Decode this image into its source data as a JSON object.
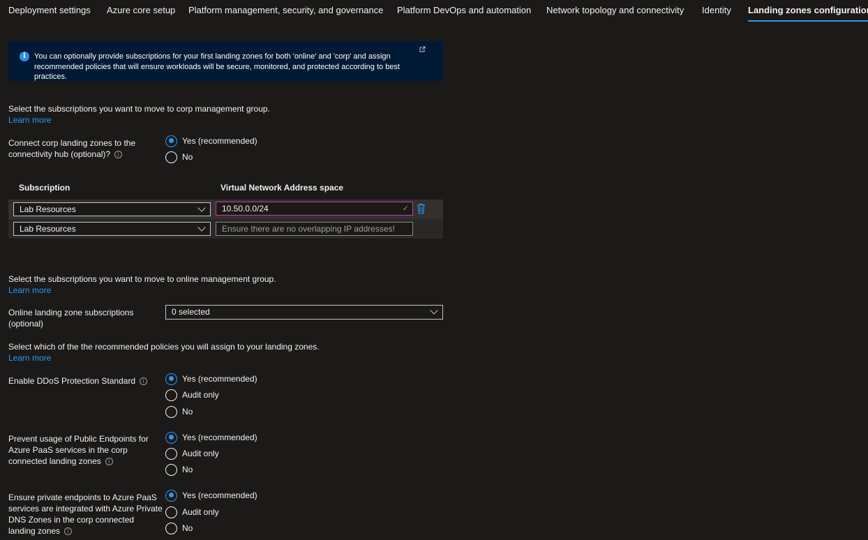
{
  "tabs": [
    {
      "label": "Deployment settings",
      "active": false
    },
    {
      "label": "Azure core setup",
      "active": false
    },
    {
      "label": "Platform management, security, and governance",
      "active": false
    },
    {
      "label": "Platform DevOps and automation",
      "active": false
    },
    {
      "label": "Network topology and connectivity",
      "active": false
    },
    {
      "label": "Identity",
      "active": false
    },
    {
      "label": "Landing zones configuration",
      "active": true
    }
  ],
  "info": {
    "icon": "info-icon",
    "text": "You can optionally provide subscriptions for your first landing zones for both 'online' and 'corp' and assign recommended policies that will ensure workloads will be secure, monitored, and protected according to best practices.",
    "external_icon": "external-link-icon"
  },
  "corp": {
    "intro": "Select the subscriptions you want to move to corp management group.",
    "learn_more": "Learn more",
    "connect_label": "Connect corp landing zones to the connectivity hub (optional)?",
    "connect_options": [
      {
        "label": "Yes (recommended)",
        "checked": true
      },
      {
        "label": "No",
        "checked": false
      }
    ],
    "grid": {
      "headers": [
        "Subscription",
        "Virtual Network Address space"
      ],
      "rows": [
        {
          "subscription": "Lab Resources",
          "address": "10.50.0.0/24",
          "placeholder": "",
          "valid": true
        },
        {
          "subscription": "Lab Resources",
          "address": "",
          "placeholder": "Ensure there are no overlapping IP addresses!",
          "valid": false
        }
      ]
    }
  },
  "online": {
    "intro": "Select the subscriptions you want to move to online management group.",
    "learn_more": "Learn more",
    "subs_label": "Online landing zone subscriptions (optional)",
    "subs_value": "0 selected"
  },
  "policies": {
    "intro": "Select which of the the recommended policies you will assign to your landing zones.",
    "learn_more": "Learn more",
    "items": [
      {
        "label": "Enable DDoS Protection Standard",
        "options": [
          {
            "label": "Yes (recommended)",
            "checked": true
          },
          {
            "label": "Audit only",
            "checked": false
          },
          {
            "label": "No",
            "checked": false
          }
        ]
      },
      {
        "label": "Prevent usage of Public Endpoints for Azure PaaS services in the corp connected landing zones",
        "options": [
          {
            "label": "Yes (recommended)",
            "checked": true
          },
          {
            "label": "Audit only",
            "checked": false
          },
          {
            "label": "No",
            "checked": false
          }
        ]
      },
      {
        "label": "Ensure private endpoints to Azure PaaS services are integrated with Azure Private DNS Zones in the corp connected landing zones",
        "options": [
          {
            "label": "Yes (recommended)",
            "checked": true
          },
          {
            "label": "Audit only",
            "checked": false
          },
          {
            "label": "No",
            "checked": false
          }
        ]
      }
    ]
  },
  "colors": {
    "accent": "#2899f5",
    "info_bg": "#001a35",
    "valid_border": "#c239b3",
    "check": "#6bb700"
  }
}
